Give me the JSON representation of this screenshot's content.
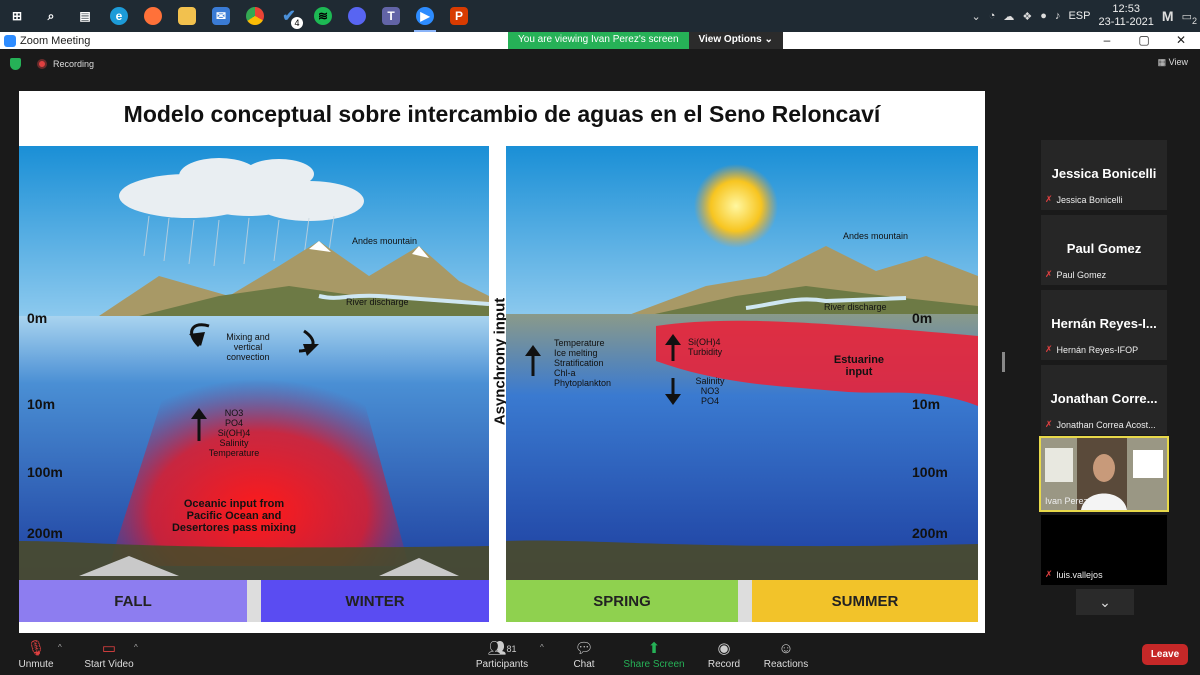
{
  "taskbar": {
    "apps": [
      {
        "icon": "windows-start-icon",
        "color": "#ffffff",
        "label": ""
      },
      {
        "icon": "search-icon",
        "color": "#ffffff",
        "label": ""
      },
      {
        "icon": "task-view-icon",
        "color": "#ffffff",
        "label": ""
      },
      {
        "icon": "edge-icon",
        "color": "#1d9bd8",
        "label": ""
      },
      {
        "icon": "firefox-icon",
        "color": "#ff7139",
        "label": ""
      },
      {
        "icon": "file-explorer-icon",
        "color": "#f2c14e",
        "label": ""
      },
      {
        "icon": "mail-icon",
        "color": "#3a7bd5",
        "label": ""
      },
      {
        "icon": "chrome-icon",
        "color": "#e8b72a",
        "label": ""
      },
      {
        "icon": "check-app-icon",
        "color": "#4a90d9",
        "label": "4"
      },
      {
        "icon": "spotify-icon",
        "color": "#1db954",
        "label": ""
      },
      {
        "icon": "discord-icon",
        "color": "#5865f2",
        "label": ""
      },
      {
        "icon": "teams-icon",
        "color": "#6264a7",
        "label": ""
      },
      {
        "icon": "zoom-icon",
        "color": "#2d8cff",
        "label": ""
      },
      {
        "icon": "office-icon",
        "color": "#d83b01",
        "label": ""
      }
    ],
    "language": "ESP",
    "time": "12:53",
    "date": "23-11-2021",
    "notifications": "2"
  },
  "window": {
    "title": "Zoom Meeting",
    "viewing_banner": "You are viewing Ivan Perez's screen",
    "view_options": "View Options ⌄"
  },
  "meeting": {
    "recording_label": "Recording",
    "view_label": "View"
  },
  "slide": {
    "title": "Modelo conceptual sobre intercambio de aguas en el Seno Reloncaví",
    "asynchrony_label": "Asynchrony input",
    "left": {
      "mountain_label": "Andes mountain",
      "river_label": "River discharge",
      "depths": [
        "0m",
        "10m",
        "100m",
        "200m"
      ],
      "mixing_label": "Mixing and vertical convection",
      "nutrients": [
        "NO3",
        "PO4",
        "Si(OH)4",
        "Salinity",
        "Temperature"
      ],
      "oceanic_label": "Oceanic input from Pacific Ocean and Desertores pass mixing",
      "seasons": [
        "FALL",
        "WINTER"
      ]
    },
    "right": {
      "mountain_label": "Andes mountain",
      "river_label": "River discharge",
      "depths": [
        "0m",
        "10m",
        "100m",
        "200m"
      ],
      "up_list": [
        "Temperature",
        "Ice melting",
        "Stratification",
        "Chl-a",
        "Phytoplankton"
      ],
      "up_short": [
        "Si(OH)4",
        "Turbidity"
      ],
      "down_list": [
        "Salinity",
        "NO3",
        "PO4"
      ],
      "estuarine_label": "Estuarine input",
      "seasons": [
        "SPRING",
        "SUMMER"
      ]
    }
  },
  "participants": [
    {
      "name": "Jessica Bonicelli",
      "sub": "Jessica Bonicelli"
    },
    {
      "name": "Paul Gomez",
      "sub": "Paul Gomez"
    },
    {
      "name": "Hernán  Reyes-I...",
      "sub": "Hernán Reyes-IFOP"
    },
    {
      "name": "Jonathan  Corre...",
      "sub": "Jonathan Correa Acost..."
    },
    {
      "name": "",
      "sub": "Ivan Perez"
    },
    {
      "name": "",
      "sub": "luis.vallejos"
    }
  ],
  "toolbar": {
    "unmute": "Unmute",
    "start_video": "Start Video",
    "participants": "Participants",
    "participants_count": "81",
    "chat": "Chat",
    "share_screen": "Share Screen",
    "record": "Record",
    "reactions": "Reactions",
    "leave": "Leave"
  },
  "colors": {
    "share_green": "#26b157",
    "leave_red": "#c62828",
    "active_speaker": "#e8d94a"
  }
}
